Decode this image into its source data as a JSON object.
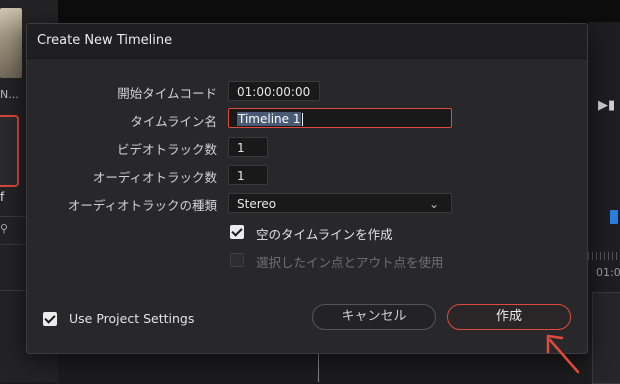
{
  "background": {
    "clip_label_1": "N...",
    "clip_label_2": "f",
    "timecode_partial": "01:0"
  },
  "dialog": {
    "title": "Create New Timeline",
    "fields": {
      "start_timecode": {
        "label": "開始タイムコード",
        "value": "01:00:00:00"
      },
      "timeline_name": {
        "label": "タイムライン名",
        "value": "Timeline 1"
      },
      "video_tracks": {
        "label": "ビデオトラック数",
        "value": "1"
      },
      "audio_tracks": {
        "label": "オーディオトラック数",
        "value": "1"
      },
      "audio_track_type": {
        "label": "オーディオトラックの種類",
        "value": "Stereo"
      }
    },
    "checkboxes": {
      "empty_timeline": {
        "label": "空のタイムラインを作成",
        "checked": true
      },
      "use_in_out": {
        "label": "選択したイン点とアウト点を使用",
        "checked": false,
        "disabled": true
      },
      "use_project_settings": {
        "label": "Use Project Settings",
        "checked": true
      }
    },
    "buttons": {
      "cancel": "キャンセル",
      "create": "作成"
    }
  },
  "colors": {
    "accent_red": "#e0493e",
    "dialog_bg": "#28282a",
    "header_bg": "#1f1f21"
  }
}
